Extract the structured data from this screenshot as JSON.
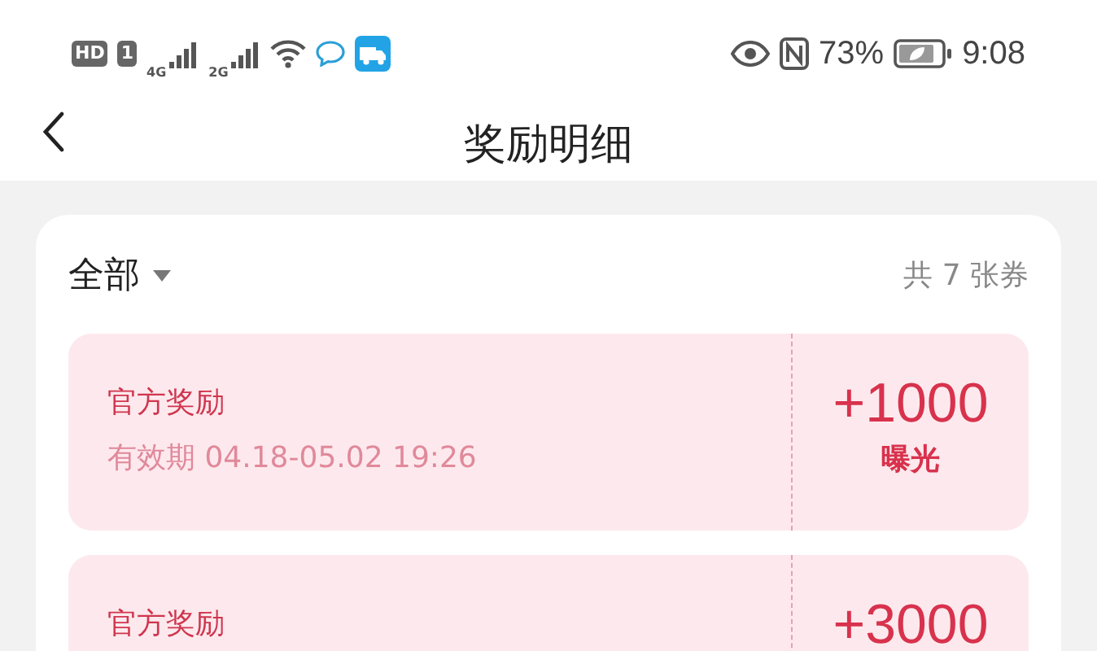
{
  "status_bar": {
    "hd": "HD",
    "sim": "1",
    "network_1": "4G",
    "network_2": "2G",
    "battery": "73%",
    "time": "9:08"
  },
  "header": {
    "title": "奖励明细"
  },
  "filter": {
    "label": "全部",
    "count": "共 7 张券"
  },
  "coupons": [
    {
      "title": "官方奖励",
      "validity": "有效期 04.18-05.02 19:26",
      "amount": "+1000",
      "unit": "曝光"
    },
    {
      "title": "官方奖励",
      "amount": "+3000"
    }
  ]
}
